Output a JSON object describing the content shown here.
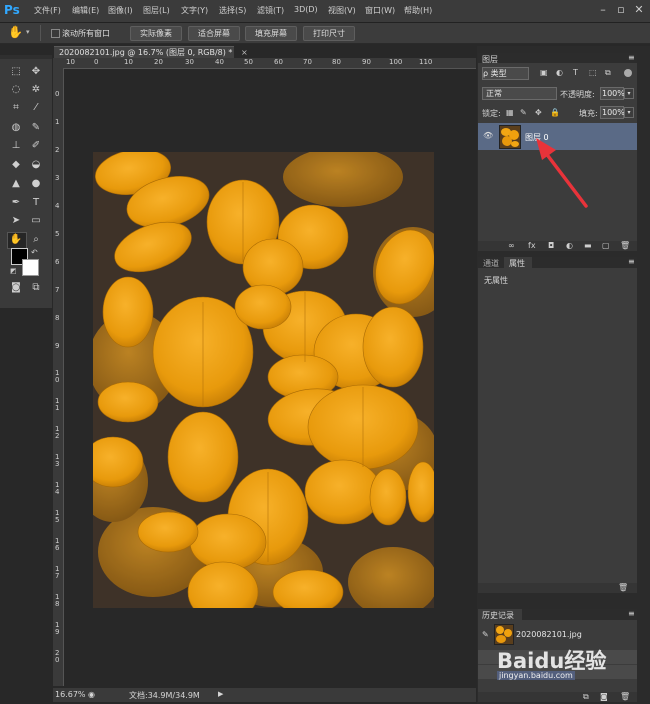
{
  "menu": {
    "logo": "Ps",
    "items": [
      "文件(F)",
      "编辑(E)",
      "图像(I)",
      "图层(L)",
      "文字(Y)",
      "选择(S)",
      "滤镜(T)",
      "3D(D)",
      "视图(V)",
      "窗口(W)",
      "帮助(H)"
    ]
  },
  "options": {
    "scroll_all": "滚动所有窗口",
    "buttons": [
      "实际像素",
      "适合屏幕",
      "填充屏幕",
      "打印尺寸"
    ]
  },
  "document": {
    "tab_title": "2020082101.jpg @ 16.7% (图层 0, RGB/8) *",
    "close": "×",
    "h_ticks": [
      "10",
      "0",
      "10",
      "20",
      "30",
      "40",
      "50",
      "60",
      "70",
      "80",
      "90",
      "100",
      "110"
    ],
    "v_ticks": [
      "0",
      "1",
      "2",
      "3",
      "4",
      "5",
      "6",
      "7",
      "8",
      "9",
      "1 0",
      "1 1",
      "1 2",
      "1 3",
      "1 4",
      "1 5",
      "1 6",
      "1 7",
      "1 8",
      "1 9",
      "2 0",
      "2 1",
      "2 2"
    ]
  },
  "status": {
    "zoom": "16.67%",
    "doc_info": "文档:34.9M/34.9M"
  },
  "layers_panel": {
    "title": "图层",
    "filter_label": "ρ 类型",
    "blend_mode": "正常",
    "opacity_label": "不透明度:",
    "opacity_value": "100%",
    "lock_label": "锁定:",
    "fill_label": "填充:",
    "fill_value": "100%",
    "layer_name": "图层 0"
  },
  "properties_panel": {
    "tabs": [
      "通道",
      "属性"
    ],
    "content": "无属性"
  },
  "history_panel": {
    "title": "历史记录",
    "item": "2020082101.jpg"
  },
  "watermark": {
    "text": "Baidu经验",
    "url": "jingyan.baidu.com"
  },
  "colors": {
    "accent": "#31a8ff",
    "arrow": "#e8333a",
    "leaf": "#f0a30c",
    "selected_layer": "#5a6a86"
  }
}
